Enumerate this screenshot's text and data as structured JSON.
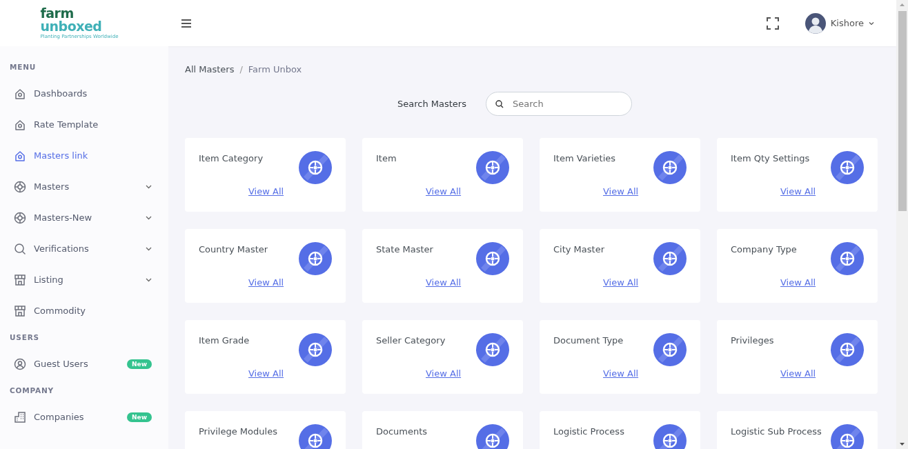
{
  "logo": {
    "word_top": "farm",
    "word_bottom": "unboxed",
    "tagline": "Planting Partnerships Worldwide"
  },
  "header": {
    "user_name": "Kishore"
  },
  "sidebar": {
    "sections": [
      {
        "title": "MENU",
        "items": [
          {
            "label": "Dashboards",
            "selected": false,
            "expandable": false
          },
          {
            "label": "Rate Template",
            "selected": false,
            "expandable": false
          },
          {
            "label": "Masters link",
            "selected": true,
            "expandable": false
          },
          {
            "label": "Masters",
            "selected": false,
            "expandable": true
          },
          {
            "label": "Masters-New",
            "selected": false,
            "expandable": true
          },
          {
            "label": "Verifications",
            "selected": false,
            "expandable": true
          },
          {
            "label": "Listing",
            "selected": false,
            "expandable": true
          },
          {
            "label": "Commodity",
            "selected": false,
            "expandable": false
          }
        ]
      },
      {
        "title": "USERS",
        "items": [
          {
            "label": "Guest Users",
            "selected": false,
            "expandable": false,
            "badge": "New"
          }
        ]
      },
      {
        "title": "COMPANY",
        "items": [
          {
            "label": "Companies",
            "selected": false,
            "expandable": false,
            "badge": "New"
          }
        ]
      }
    ]
  },
  "breadcrumb": {
    "items": [
      "All Masters",
      "Farm Unbox"
    ],
    "separator": "/"
  },
  "search": {
    "label": "Search Masters",
    "placeholder": "Search"
  },
  "cards": [
    {
      "title": "Item Category",
      "link": "View All"
    },
    {
      "title": "Item",
      "link": "View All"
    },
    {
      "title": "Item Varieties",
      "link": "View All"
    },
    {
      "title": "Item Qty Settings",
      "link": "View All"
    },
    {
      "title": "Country Master",
      "link": "View All"
    },
    {
      "title": "State Master",
      "link": "View All"
    },
    {
      "title": "City Master",
      "link": "View All"
    },
    {
      "title": "Company Type",
      "link": "View All"
    },
    {
      "title": "Item Grade",
      "link": "View All"
    },
    {
      "title": "Seller Category",
      "link": "View All"
    },
    {
      "title": "Document Type",
      "link": "View All"
    },
    {
      "title": "Privileges",
      "link": "View All"
    },
    {
      "title": "Privilege Modules"
    },
    {
      "title": "Documents"
    },
    {
      "title": "Logistic Process"
    },
    {
      "title": "Logistic Sub Process"
    }
  ]
}
